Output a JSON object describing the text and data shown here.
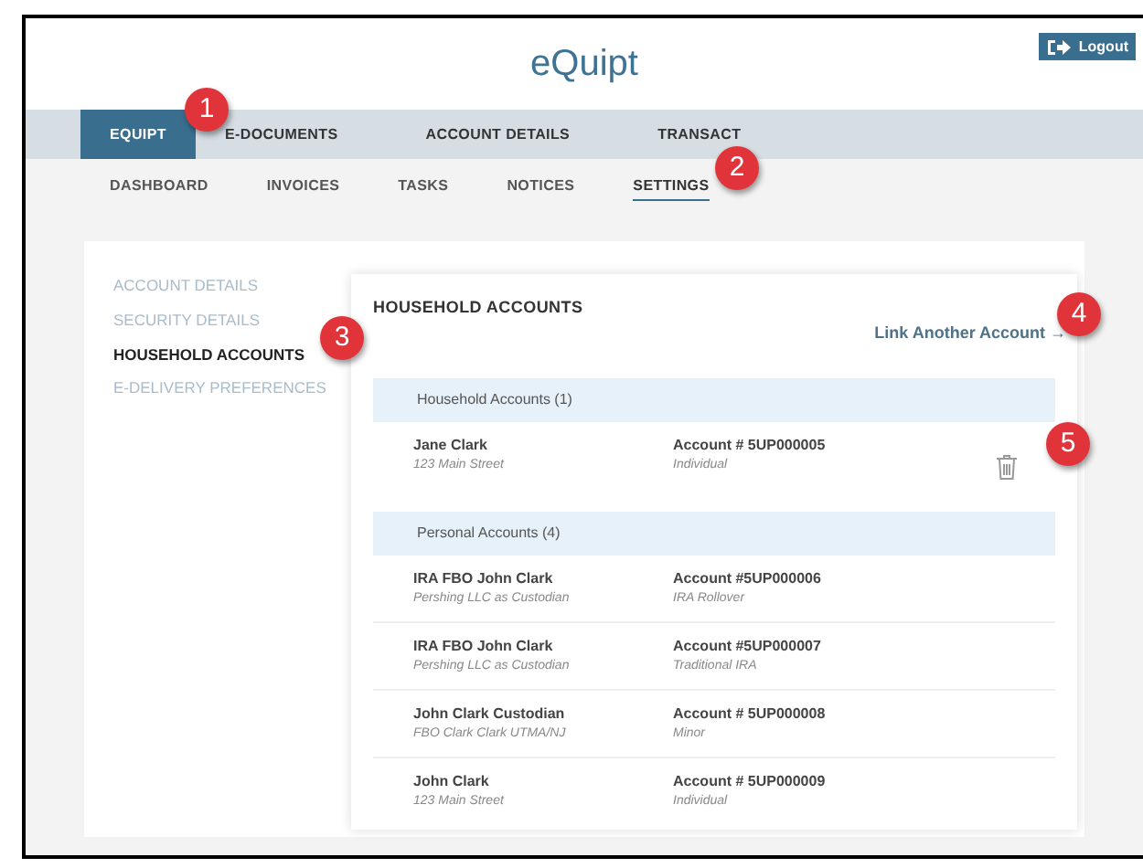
{
  "header": {
    "logo": "eQuipt",
    "logout_button": "Logout"
  },
  "main_tabs": [
    {
      "label": "EQUIPT",
      "selected": true
    },
    {
      "label": "E-DOCUMENTS",
      "selected": false
    },
    {
      "label": "ACCOUNT DETAILS",
      "selected": false
    },
    {
      "label": "TRANSACT",
      "selected": false
    }
  ],
  "sub_tabs": [
    {
      "label": "DASHBOARD",
      "selected": false
    },
    {
      "label": "INVOICES",
      "selected": false
    },
    {
      "label": "TASKS",
      "selected": false
    },
    {
      "label": "NOTICES",
      "selected": false
    },
    {
      "label": "SETTINGS",
      "selected": true
    }
  ],
  "sidebar": {
    "items": [
      {
        "label": "ACCOUNT DETAILS",
        "selected": false
      },
      {
        "label": "SECURITY DETAILS",
        "selected": false
      },
      {
        "label": "HOUSEHOLD ACCOUNTS",
        "selected": true
      },
      {
        "label": "E-DELIVERY PREFERENCES",
        "selected": false
      }
    ]
  },
  "panel": {
    "title": "HOUSEHOLD ACCOUNTS",
    "link": "Link Another Account",
    "link_arrow": "→",
    "groups": [
      {
        "heading": "Household Accounts (1)",
        "rows": [
          {
            "name": "Jane Clark",
            "detail": "123 Main Street",
            "account": "Account # 5UP000005",
            "type": "Individual",
            "deletable": true
          }
        ]
      },
      {
        "heading": "Personal Accounts (4)",
        "rows": [
          {
            "name": "IRA FBO John Clark",
            "detail": "Pershing LLC as Custodian",
            "account": "Account #5UP000006",
            "type": "IRA Rollover",
            "deletable": false
          },
          {
            "name": "IRA FBO John Clark",
            "detail": "Pershing LLC as Custodian",
            "account": "Account #5UP000007",
            "type": "Traditional IRA",
            "deletable": false
          },
          {
            "name": "John Clark Custodian",
            "detail": "FBO Clark Clark UTMA/NJ",
            "account": "Account # 5UP000008",
            "type": "Minor",
            "deletable": false
          },
          {
            "name": "John Clark",
            "detail": "123 Main Street",
            "account": "Account # 5UP000009",
            "type": "Individual",
            "deletable": false
          }
        ]
      }
    ]
  },
  "callouts": [
    "1",
    "2",
    "3",
    "4",
    "5"
  ]
}
